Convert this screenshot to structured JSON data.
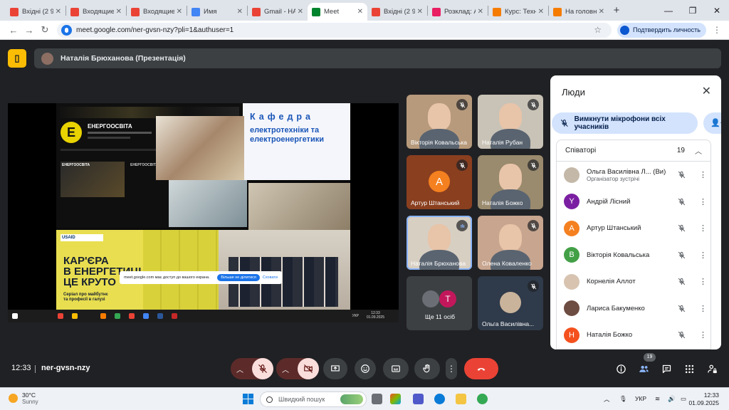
{
  "browser": {
    "tabs": [
      {
        "label": "Вхідні (2 9",
        "color": "#ea4335"
      },
      {
        "label": "Входящие",
        "color": "#ea4335"
      },
      {
        "label": "Входящие",
        "color": "#ea4335"
      },
      {
        "label": "Имя",
        "color": "#4285f4"
      },
      {
        "label": "Gmail - НА",
        "color": "#ea4335"
      },
      {
        "label": "Meet",
        "color": "#00832d",
        "active": true
      },
      {
        "label": "Вхідні (2 9",
        "color": "#ea4335"
      },
      {
        "label": "Розклад: А",
        "color": "#e91e63"
      },
      {
        "label": "Курс: Техн",
        "color": "#f57c00"
      },
      {
        "label": "На головну",
        "color": "#f57c00"
      }
    ],
    "new_tab": "+",
    "url": "meet.google.com/ner-gvsn-nzy?pli=1&authuser=1",
    "verify_label": "Подтвердить личность"
  },
  "meet": {
    "presenter_label": "Наталія Брюханова (Презентація)",
    "time": "12:33",
    "meeting_code": "ner-gvsn-nzy",
    "participants_badge": "19"
  },
  "share": {
    "channel_name": "ЕНЕРГООСВІТА",
    "video_label": "ЕНЕРГООСВІТА",
    "video_label2": "ЕНЕРГООСВІТА",
    "dept_line1": "Кафедра",
    "dept_line2": "електротехніки та",
    "dept_line3": "електроенергетики",
    "usaid": "USAID",
    "career_l1": "КАР'ЄРА",
    "career_l2": "В ЕНЕРГЕТИЦІ -",
    "career_l3": "ЦЕ КРУТО",
    "career_small1": "Серіал про майбутнє",
    "career_small2": "та професії в галузі",
    "cookie_text": "meet.google.com має доступ до вашого екрана.",
    "cookie_btn": "Більше не ділитися",
    "cookie_link": "Сховати",
    "task_lang": "УКР",
    "task_time": "12:33",
    "task_date": "01.09.2025"
  },
  "tiles": [
    {
      "name": "Вікторія Ковальська",
      "kind": "video",
      "bg": "#b79a7c"
    },
    {
      "name": "Наталія Рубан",
      "kind": "video",
      "bg": "#c9c3b7"
    },
    {
      "name": "Артур Штанський",
      "kind": "avatar",
      "letter": "A",
      "bg": "#8a3f1f",
      "avcolor": "#f4801f"
    },
    {
      "name": "Наталія Божко",
      "kind": "video",
      "bg": "#9a8a6e"
    },
    {
      "name": "Наталія Брюханова",
      "kind": "video",
      "bg": "#d8cfc3",
      "speaking": true
    },
    {
      "name": "Олена Коваленко",
      "kind": "video",
      "bg": "#c7a58f"
    },
    {
      "name": "Ще 11 осіб",
      "kind": "more",
      "letter": "T",
      "bg": "#3c4043"
    },
    {
      "name": "Ольга Василівна...",
      "kind": "avatar-photo",
      "bg": "#2f3a4a"
    }
  ],
  "people_panel": {
    "title": "Люди",
    "mute_all": "Вимкнути мікрофони всіх учасників",
    "section_title": "Співаторі",
    "section_count": "19",
    "participants": [
      {
        "name": "Ольга Василівна Л... (Ви)",
        "role": "Організатор зустрічі",
        "color": "#c4b8a8",
        "letter": ""
      },
      {
        "name": "Андрій Лісний",
        "role": "",
        "color": "#7b1fa2",
        "letter": "Y"
      },
      {
        "name": "Артур Штанський",
        "role": "",
        "color": "#f4801f",
        "letter": "A"
      },
      {
        "name": "Вікторія Ковальська",
        "role": "",
        "color": "#43a047",
        "letter": "B"
      },
      {
        "name": "Корнелія Аллот",
        "role": "",
        "color": "#d7c3b0",
        "letter": ""
      },
      {
        "name": "Лариса Бакуменко",
        "role": "",
        "color": "#6d4c41",
        "letter": ""
      },
      {
        "name": "Наталія Божко",
        "role": "",
        "color": "#f4511e",
        "letter": "H"
      }
    ]
  },
  "taskbar": {
    "temp": "30°C",
    "weather": "Sunny",
    "search": "Швидкий пошук",
    "lang": "УКР",
    "time": "12:33",
    "date": "01.09.2025"
  }
}
